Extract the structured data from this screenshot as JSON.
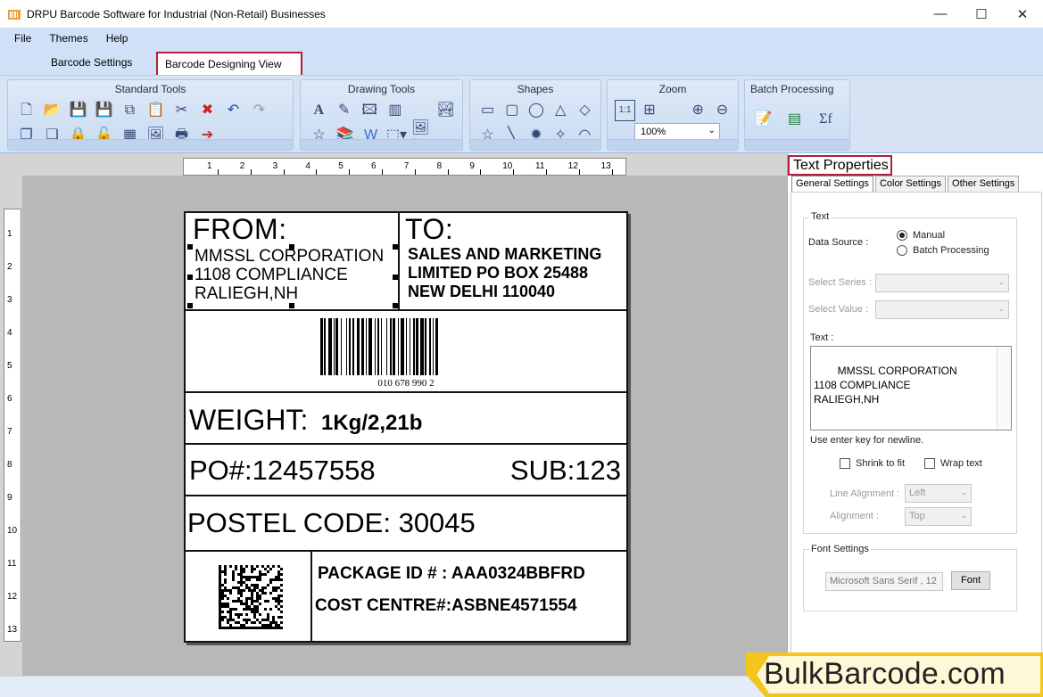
{
  "window": {
    "title": "DRPU Barcode Software for Industrial (Non-Retail) Businesses",
    "controls": [
      "—",
      "☐",
      "✕"
    ]
  },
  "menu": [
    "File",
    "Themes",
    "Help"
  ],
  "view_tabs": {
    "settings": "Barcode Settings",
    "designing": "Barcode Designing View"
  },
  "ribbon": {
    "standard": "Standard Tools",
    "drawing": "Drawing Tools",
    "shapes": "Shapes",
    "zoom": "Zoom",
    "zoom_value": "100%",
    "batch": "Batch Processing"
  },
  "ruler": {
    "top": [
      "1",
      "2",
      "3",
      "4",
      "5",
      "6",
      "7",
      "8",
      "9",
      "10",
      "11",
      "12",
      "13"
    ],
    "left": [
      "1",
      "2",
      "3",
      "4",
      "5",
      "6",
      "7",
      "8",
      "9",
      "10",
      "11",
      "12",
      "13"
    ]
  },
  "label": {
    "from_title": "FROM:",
    "from_lines": [
      "MMSSL CORPORATION",
      "1108 COMPLIANCE",
      "RALIEGH,NH"
    ],
    "to_title": "TO:",
    "to_lines": [
      "SALES AND MARKETING",
      "LIMITED PO BOX 25488",
      "NEW DELHI 110040"
    ],
    "barcode_text": "010 678 990 2",
    "weight_label": "WEIGHT:",
    "weight_value": "1Kg/2,21b",
    "po": "PO#:12457558",
    "sub": "SUB:123",
    "postal": "POSTEL CODE: 30045",
    "package_id": "PACKAGE ID # : AAA0324BBFRD",
    "cost_centre": "COST CENTRE#:ASBNE4571554"
  },
  "props": {
    "title": "Text Properties",
    "tabs": [
      "General Settings",
      "Color Settings",
      "Other Settings"
    ],
    "text_group": "Text",
    "data_source_label": "Data Source :",
    "data_source_options": [
      "Manual",
      "Batch Processing"
    ],
    "select_series": "Select Series :",
    "select_value": "Select Value :",
    "text_label": "Text :",
    "text_value": "MMSSL CORPORATION\n1108 COMPLIANCE\nRALIEGH,NH",
    "hint": "Use enter key for newline.",
    "shrink": "Shrink to fit",
    "wrap": "Wrap text",
    "line_alignment_label": "Line Alignment :",
    "line_alignment_value": "Left",
    "alignment_label": "Alignment :",
    "alignment_value": "Top",
    "font_group": "Font Settings",
    "font_value": "Microsoft Sans Serif , 12",
    "font_button": "Font"
  },
  "watermark": "BulkBarcode.com"
}
